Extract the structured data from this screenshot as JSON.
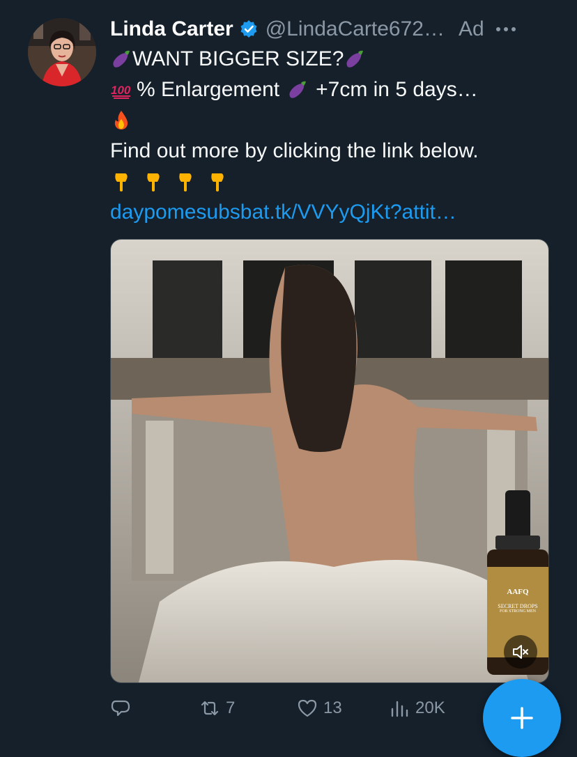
{
  "tweet": {
    "author_name": "Linda Carter",
    "handle": "@LindaCarte672…",
    "ad_label": "Ad",
    "lines": [
      "WANT BIGGER SIZE?",
      "% Enlargement",
      "+7cm in 5 days…",
      "Find out more by clicking the link below."
    ],
    "link": "daypomesubsbat.tk/VVYyQjKt?attit…"
  },
  "media": {
    "product_brand": "AAFQ",
    "product_line1": "SECRET DROPS",
    "product_line2": "FOR STRONG MEN"
  },
  "actions": {
    "retweets": "7",
    "likes": "13",
    "views": "20K"
  },
  "icons": {
    "verified": "verified-badge-icon",
    "more": "more-options-icon",
    "eggplant": "eggplant-emoji",
    "hundred": "hundred-points-emoji",
    "fire": "fire-emoji",
    "pointing_down": "backhand-index-pointing-down-emoji",
    "mute": "speaker-muted-icon",
    "reply": "reply-icon",
    "retweet": "retweet-icon",
    "like": "heart-icon",
    "views": "views-icon",
    "compose": "compose-plus-icon"
  },
  "colors": {
    "background": "#15202b",
    "accent": "#1d9bf0",
    "secondary_text": "#8b98a5"
  }
}
